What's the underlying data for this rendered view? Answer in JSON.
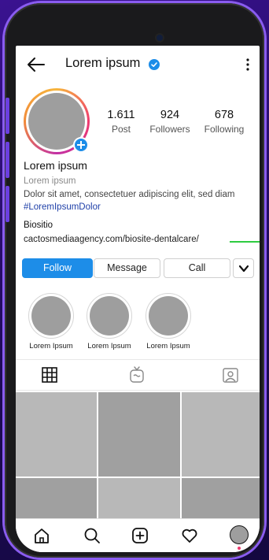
{
  "header": {
    "title": "Lorem ipsum"
  },
  "profile": {
    "stats": [
      {
        "value": "1.611",
        "label": "Post"
      },
      {
        "value": "924",
        "label": "Followers"
      },
      {
        "value": "678",
        "label": "Following"
      }
    ],
    "name": "Lorem ipsum",
    "category": "Lorem ipsum",
    "bio_text": "Dolor sit amet, consectetuer adipiscing elit, sed diam ",
    "bio_hashtag": "#LoremIpsumDolor",
    "site_title": "Biositio",
    "site_link": "cactosmediaagency.com/biosite-dentalcare/"
  },
  "actions": {
    "follow": "Follow",
    "message": "Message",
    "call": "Call"
  },
  "highlights": [
    {
      "label": "Lorem Ipsum"
    },
    {
      "label": "Lorem Ipsum"
    },
    {
      "label": "Lorem Ipsum"
    }
  ],
  "tabs": [
    {
      "icon": "grid-icon"
    },
    {
      "icon": "igtv-icon"
    },
    {
      "icon": "tagged-icon"
    }
  ],
  "bottom_nav": [
    {
      "icon": "home-icon"
    },
    {
      "icon": "search-icon"
    },
    {
      "icon": "add-post-icon"
    },
    {
      "icon": "heart-icon"
    },
    {
      "icon": "profile-avatar"
    }
  ],
  "colors": {
    "accent": "#1d8de8",
    "hashtag": "#1e3fa8",
    "link_underline": "#2ecc40",
    "phone_frame": "#8a5cf0",
    "background": "#2a0f6e",
    "placeholder_gray": "#9e9e9e"
  }
}
